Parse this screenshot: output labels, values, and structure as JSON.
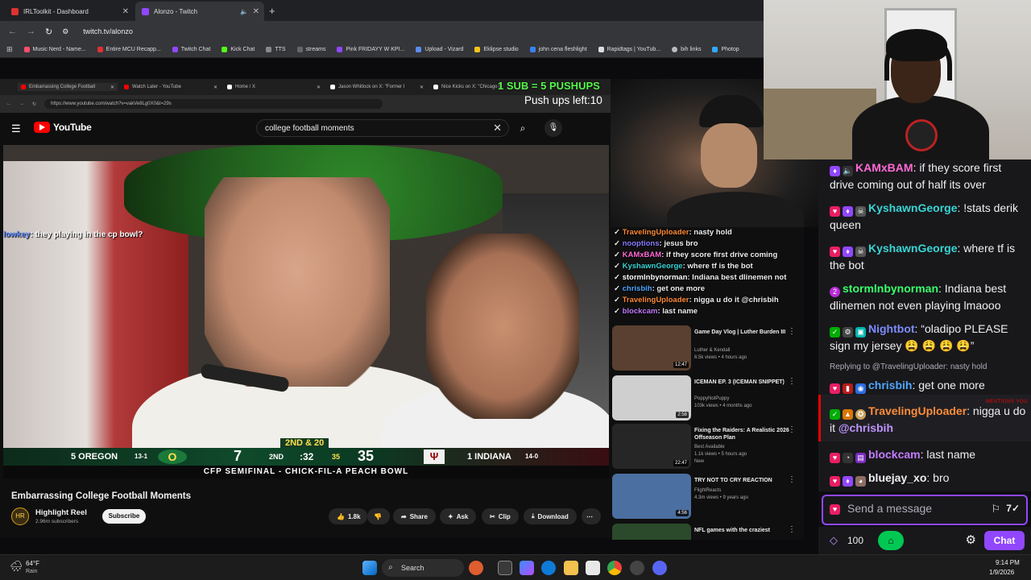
{
  "browser": {
    "tabs": [
      {
        "label": "IRLToolkit - Dashboard",
        "color": "#e03131",
        "active": false
      },
      {
        "label": "Alonzo - Twitch",
        "color": "#9147ff",
        "active": true
      }
    ],
    "url": "twitch.tv/alonzo",
    "bookmarks": [
      "Music Nerd - Name...",
      "Entire MCU Recapp...",
      "Twitch Chat",
      "Kick Chat",
      "TTS",
      "streams",
      "Pink FRIDAYY W KPI...",
      "Upload - Vizard",
      "Eklipse studio",
      "john cena fleshlight",
      "Rapidtags | YouTub...",
      "bih links",
      "Photop"
    ]
  },
  "inner": {
    "tabs": [
      "Embarrassing College Football",
      "Watch Later - YouTube",
      "Home / X",
      "Jason Whitlock on X: \"Former I",
      "Nice Kicks on X: \"Chicago B"
    ],
    "url": "https://www.youtube.com/watch?v=vakVe8Lg0X0&t=29s",
    "yt_logo": "YouTube",
    "search_value": "college football moments",
    "overlay_chat": {
      "user": "lowkey",
      "text": ": they playing in the cp bowl?"
    },
    "scoreboard": {
      "team1": "5 OREGON",
      "record1": "13-1",
      "score1": "7",
      "down": "2ND & 20",
      "quarter": "2ND",
      "clock": ":32",
      "play_clock": "35",
      "score2": "35",
      "team2": "1 INDIANA",
      "record2": "14-0"
    },
    "banner": "CFP SEMIFINAL - CHICK-FIL-A PEACH BOWL",
    "video_title": "Embarrassing College Football Moments",
    "channel": {
      "name": "Highlight Reel",
      "subs": "2.96m subscribers",
      "subscribe": "Subscribe"
    },
    "actions": {
      "likes": "1.8k",
      "share": "Share",
      "ask": "Ask",
      "clip": "Clip",
      "download": "Download"
    },
    "suggestions": [
      {
        "title": "Game Day Vlog | Luther Burden III",
        "channel": "Luther & Kendall",
        "meta": "6.5k views • 4 hours ago",
        "duration": "12:47",
        "color": "#5a4030"
      },
      {
        "title": "ICEMAN EP. 3 (ICEMAN SNIPPET)",
        "channel": "PoppyNotPuppy",
        "meta": "103k views • 4 months ago",
        "duration": "2:58",
        "color": "#cfcfcf"
      },
      {
        "title": "Fixing the Raiders: A Realistic 2026 Offseason Plan",
        "channel": "Best Available",
        "meta": "1.1k views • 5 hours ago",
        "badge": "New",
        "duration": "22:47",
        "color": "#262626"
      },
      {
        "title": "TRY NOT TO CRY REACTION",
        "channel": "FlightReacts",
        "meta": "4.3m views • 9 years ago",
        "duration": "4:56",
        "color": "#4a6fa0"
      },
      {
        "title": "NFL games with the craziest",
        "channel": "",
        "meta": "",
        "duration": "",
        "color": "#2b4a2b"
      }
    ]
  },
  "pushups": {
    "title": "1 SUB = 5 PUSHUPS",
    "left": "Push ups left:10"
  },
  "stream_overlay_chat": [
    {
      "user": "TravelingUploader",
      "text": ": nasty hold",
      "color": "#ff8c3a"
    },
    {
      "user": "nooptions",
      "text": ": jesus bro",
      "color": "#8a7cff"
    },
    {
      "user": "KAMxBAM",
      "text": ": if they score first drive coming",
      "color": "#ff6ad5"
    },
    {
      "user": "KyshawnGeorge",
      "text": ": where tf is the bot",
      "color": "#39d5d5"
    },
    {
      "user": "stormlnbynorman",
      "text": ": Indiana best dlinemen not",
      "color": "#ffffff"
    },
    {
      "user": "chrisbih",
      "text": ": get one more",
      "color": "#4fa6ff"
    },
    {
      "user": "TravelingUploader",
      "text": ": nigga u do it @chrisbih",
      "color": "#ff8c3a"
    },
    {
      "user": "blockcam",
      "text": ": last name",
      "color": "#c47cff"
    }
  ],
  "twitch_chat": {
    "messages": [
      {
        "user": "KAMxBAM",
        "text": ": if they score first drive coming out of half its over",
        "color": "#ff6ad5"
      },
      {
        "user": "KyshawnGeorge",
        "text": ": !stats derik queen",
        "color": "#39d5d5"
      },
      {
        "user": "KyshawnGeorge",
        "text": ": where tf is the bot",
        "color": "#39d5d5"
      },
      {
        "user": "stormlnbynorman",
        "text": ": Indiana best dlinemen not even playing lmaooo",
        "color": "#39ff6a"
      },
      {
        "user": "Nightbot",
        "text": ": “oladipo PLEASE sign my jersey 😩 😩 😩 😩”",
        "color": "#7c8cff"
      },
      {
        "user": "chrisbih",
        "text": ": get one more",
        "color": "#4fa6ff"
      },
      {
        "user": "TravelingUploader",
        "text": ": nigga u do it ",
        "mention": "@chrisbih",
        "color": "#ff8c3a"
      },
      {
        "user": "blockcam",
        "text": ": last name",
        "color": "#c47cff"
      },
      {
        "user": "bluejay_xo",
        "text": ": bro",
        "color": "#efeff1"
      }
    ],
    "reply_context": "Replying to @TravelingUploader: nasty hold",
    "mention_tag": "MENTIONS YOU",
    "placeholder": "Send a message",
    "points": "100",
    "chat_button": "Chat"
  },
  "taskbar": {
    "weather_temp": "64°F",
    "weather_desc": "Rain",
    "search": "Search",
    "time": "9:14 PM",
    "date": "1/9/2026"
  }
}
